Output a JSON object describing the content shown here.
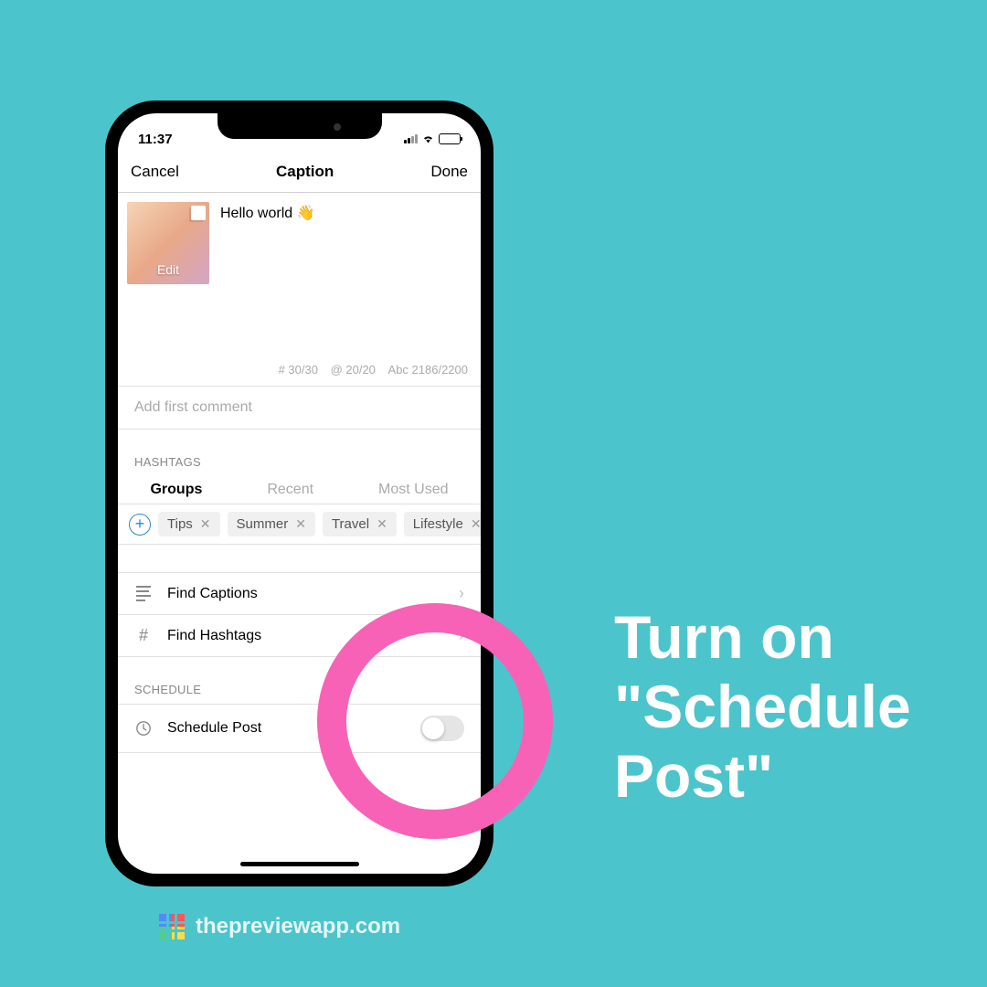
{
  "status": {
    "time": "11:37"
  },
  "nav": {
    "cancel": "Cancel",
    "title": "Caption",
    "done": "Done"
  },
  "caption": {
    "text": "Hello world 👋",
    "edit": "Edit"
  },
  "counters": {
    "hash": "# 30/30",
    "at": "@ 20/20",
    "abc": "Abc 2186/2200"
  },
  "firstComment": {
    "placeholder": "Add first comment"
  },
  "sections": {
    "hashtags": "HASHTAGS",
    "schedule": "SCHEDULE"
  },
  "tabs": {
    "groups": "Groups",
    "recent": "Recent",
    "mostUsed": "Most Used"
  },
  "tags": [
    "Tips",
    "Summer",
    "Travel",
    "Lifestyle"
  ],
  "rows": {
    "findCaptions": "Find Captions",
    "findHashtags": "Find Hashtags",
    "schedulePost": "Schedule Post"
  },
  "callout": "Turn on \"Schedule Post\"",
  "footer": "thepreviewapp.com"
}
